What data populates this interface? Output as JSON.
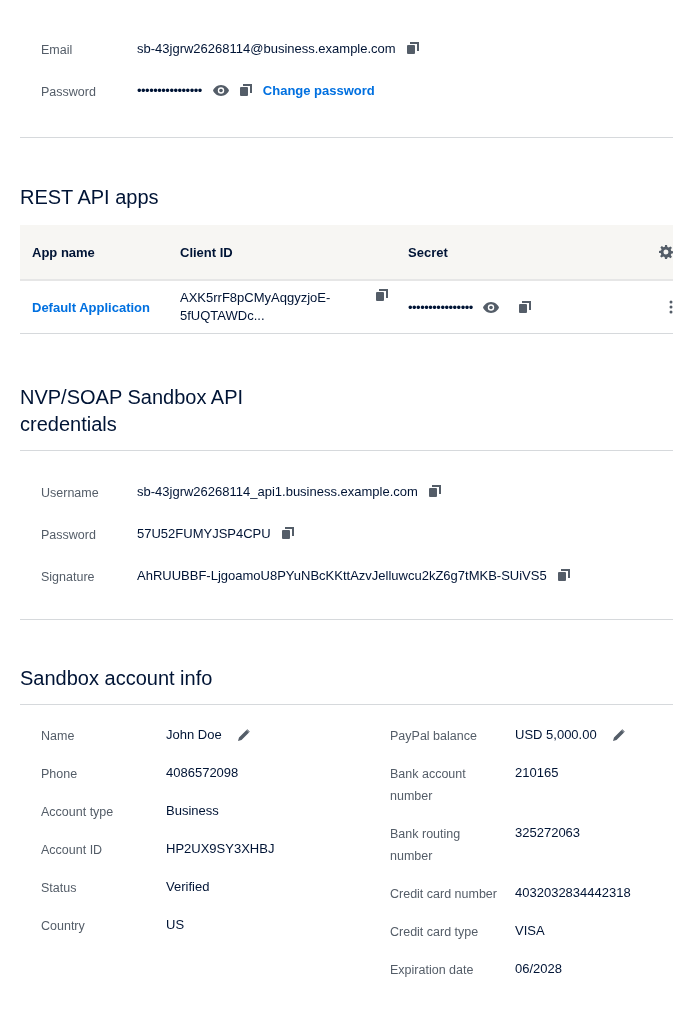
{
  "account": {
    "rows": [
      {
        "label": "Email",
        "value": "sb-43jgrw26268114@business.example.com",
        "kind": "text"
      },
      {
        "label": "Password",
        "value": "••••••••••••••••",
        "kind": "secret",
        "link": "Change password"
      }
    ]
  },
  "rest_api_apps": {
    "title": "REST API apps",
    "columns": [
      "App name",
      "Client ID",
      "Secret"
    ],
    "rows": [
      {
        "app_name": "Default Application",
        "client_id": "AXK5rrF8pCMyAqgyzjoE-5fUQTAWDc...",
        "secret": "••••••••••••••••"
      }
    ]
  },
  "nvp_soap": {
    "title": "NVP/SOAP Sandbox API credentials",
    "rows": [
      {
        "label": "Username",
        "value": "sb-43jgrw26268114_api1.business.example.com"
      },
      {
        "label": "Password",
        "value": "57U52FUMYJSP4CPU"
      },
      {
        "label": "Signature",
        "value": "AhRUUBBF-LjgoamoU8PYuNBcKKttAzvJelluwcu2kZ6g7tMKB-SUiVS5"
      }
    ]
  },
  "account_info": {
    "title": "Sandbox account info",
    "left": [
      {
        "label": "Name",
        "value": "John Doe",
        "editable": true
      },
      {
        "label": "Phone",
        "value": "4086572098",
        "editable": false
      },
      {
        "label": "Account type",
        "value": "Business",
        "editable": false
      },
      {
        "label": "Account ID",
        "value": "HP2UX9SY3XHBJ",
        "editable": false
      },
      {
        "label": "Status",
        "value": "Verified",
        "editable": false
      },
      {
        "label": "Country",
        "value": "US",
        "editable": false
      }
    ],
    "right": [
      {
        "label": "PayPal balance",
        "value": "USD 5,000.00",
        "editable": true
      },
      {
        "label": "Bank account number",
        "value": "210165",
        "editable": false
      },
      {
        "label": "Bank routing number",
        "value": "325272063",
        "editable": false
      },
      {
        "label": "Credit card number",
        "value": "4032032834442318",
        "editable": false
      },
      {
        "label": "Credit card type",
        "value": "VISA",
        "editable": false
      },
      {
        "label": "Expiration date",
        "value": "06/2028",
        "editable": false
      }
    ]
  }
}
